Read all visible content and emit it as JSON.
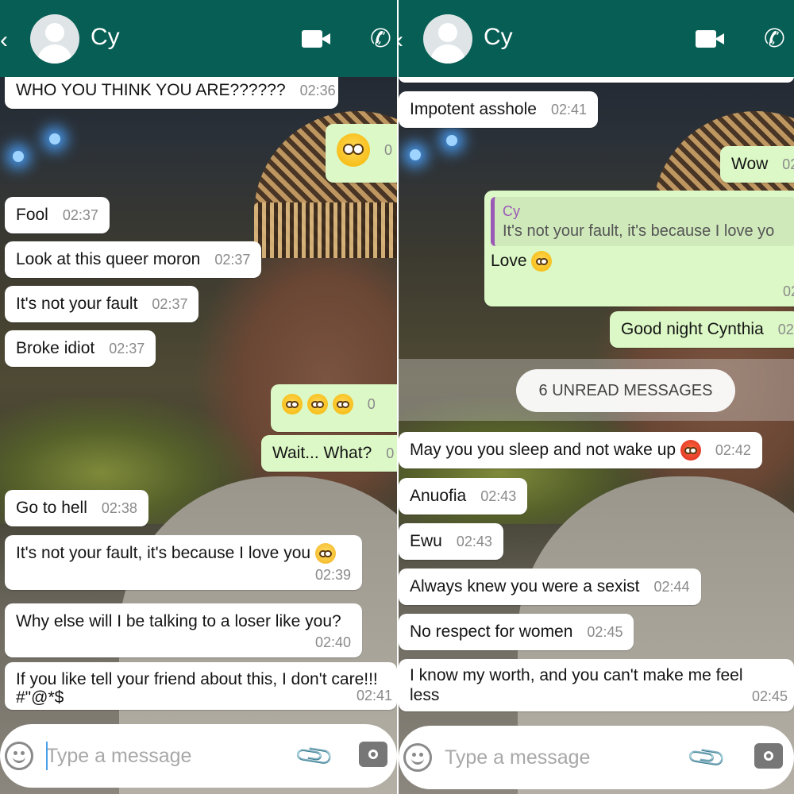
{
  "header": {
    "contact_name": "Cy"
  },
  "input": {
    "placeholder": "Type a message"
  },
  "colors": {
    "header": "#075e54",
    "incoming": "#ffffff",
    "outgoing": "#dcf8c6",
    "quote_accent": "#9b59b6"
  },
  "icons": [
    "back-icon",
    "avatar",
    "video-call-icon",
    "voice-call-icon",
    "smiley-icon",
    "attach-icon",
    "camera-icon"
  ],
  "left": {
    "messages": [
      {
        "dir": "in",
        "text": "WHO YOU THINK YOU ARE??????",
        "time": "02:36"
      },
      {
        "dir": "out",
        "emoji": "flushed",
        "time": "0"
      },
      {
        "dir": "in",
        "text": "Fool",
        "time": "02:37"
      },
      {
        "dir": "in",
        "text": "Look at this queer moron",
        "time": "02:37"
      },
      {
        "dir": "in",
        "text": "It's not your fault",
        "time": "02:37"
      },
      {
        "dir": "in",
        "text": "Broke idiot",
        "time": "02:37"
      },
      {
        "dir": "out",
        "emoji": "flushed x3",
        "time": "0"
      },
      {
        "dir": "out",
        "text": "Wait... What?",
        "time": "0"
      },
      {
        "dir": "in",
        "text": "Go to hell",
        "time": "02:38"
      },
      {
        "dir": "in",
        "text": "It's not your fault, it's because I love you",
        "emoji": "crying",
        "time": "02:39"
      },
      {
        "dir": "in",
        "text": "Why else will I be talking to a loser like you?",
        "time": "02:40"
      },
      {
        "dir": "in",
        "text": "If you like tell your friend about this, I don't care!!!",
        "text2": "#\"@*$",
        "time": "02:41"
      }
    ]
  },
  "right": {
    "unread_label": "6 UNREAD MESSAGES",
    "messages": [
      {
        "dir": "in",
        "text": "Impotent asshole",
        "time": "02:41"
      },
      {
        "dir": "out",
        "text": "Wow",
        "time": "02"
      },
      {
        "dir": "out",
        "quote_name": "Cy",
        "quote_text": "It's not your fault, it's because I love yo",
        "text": "Love",
        "emoji": "flushed",
        "time": "02"
      },
      {
        "dir": "out",
        "text": "Good night Cynthia",
        "time": "02"
      },
      {
        "dir": "in",
        "text": "May you you sleep and not wake up",
        "emoji": "angry",
        "time": "02:42"
      },
      {
        "dir": "in",
        "text": "Anuofia",
        "time": "02:43"
      },
      {
        "dir": "in",
        "text": "Ewu",
        "time": "02:43"
      },
      {
        "dir": "in",
        "text": "Always knew you were a sexist",
        "time": "02:44"
      },
      {
        "dir": "in",
        "text": "No respect for women",
        "time": "02:45"
      },
      {
        "dir": "in",
        "text": "I know my worth, and you can't make me feel less",
        "time": "02:45"
      }
    ]
  }
}
